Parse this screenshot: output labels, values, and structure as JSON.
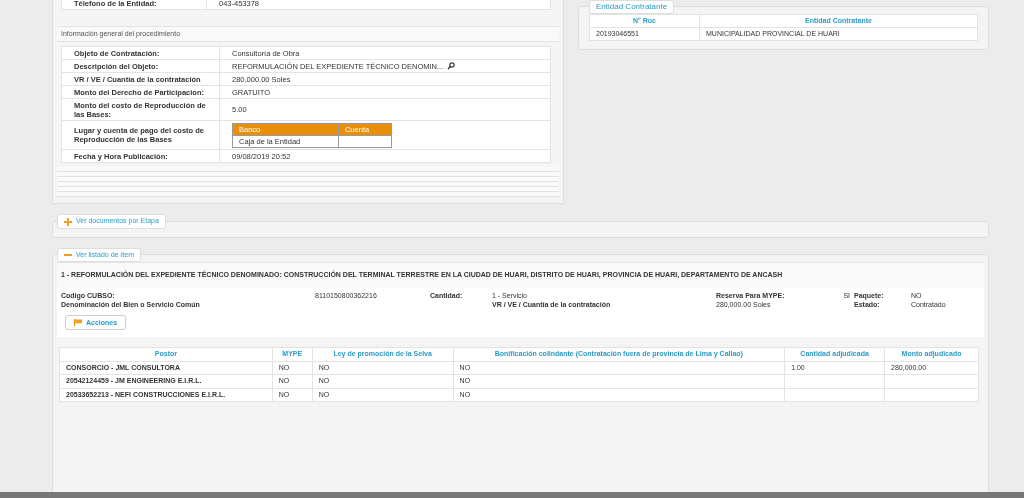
{
  "entity_info": {
    "rows": [
      {
        "label": "Télefono de la Entidad:",
        "value": "043-453378"
      }
    ]
  },
  "procedure": {
    "title": "Información general del procedimiento",
    "rows": [
      {
        "kind": "text",
        "label": "Objeto de Contratación:",
        "value": "Consultoría de Obra"
      },
      {
        "kind": "search",
        "label": "Descripción del Objeto:",
        "value": "REFORMULACIÓN DEL EXPEDIENTE TÉCNICO DENOMIN..."
      },
      {
        "kind": "text",
        "label": "VR / VE / Cuantía de la contratación",
        "value": "280,000.00  Soles"
      },
      {
        "kind": "text",
        "label": "Monto del Derecho de Participacion:",
        "value": "GRATUITO"
      },
      {
        "kind": "text",
        "label": "Monto del costo de Reproducción de las Bases:",
        "value": "5.00"
      },
      {
        "kind": "payment",
        "label": "Lugar y cuenta de pago del costo de Reproducción de las Bases",
        "columns": [
          "Banco",
          "Cuenta"
        ],
        "rows": [
          [
            "Caja de la Entidad",
            null
          ]
        ]
      },
      {
        "kind": "text",
        "label": "Fecha y Hora Publicación:",
        "value": "09/08/2019 20:52"
      }
    ]
  },
  "entidad_contratante": {
    "legend": "Entidad Contratante",
    "columns": [
      "N° Ruc",
      "Entidad Contratante"
    ],
    "rows": [
      [
        "20193046551",
        "MUNICIPALIDAD PROVINCIAL DE HUARI"
      ]
    ]
  },
  "documents": {
    "label": "Ver documentos por Etapa",
    "expanded": false
  },
  "items": {
    "label": "Ver listado de ítem",
    "expanded": true,
    "title": "1 - REFORMULACIÓN DEL EXPEDIENTE TÉCNICO DENOMINADO: CONSTRUCCIÓN DEL TERMINAL TERRESTRE EN LA CIUDAD DE HUARI, DISTRITO DE HUARI, PROVINCIA DE HUARI, DEPARTAMENTO DE ANCASH",
    "details": [
      [
        {
          "kind": "label",
          "text": "Codigo CUBSO:"
        },
        {
          "kind": "value",
          "text": "8110150800362216"
        },
        {
          "kind": "label",
          "text": "Cantidad:"
        },
        {
          "kind": "value",
          "text": "1 - Servicio"
        },
        {
          "kind": "label",
          "text": "Reserva Para MYPE:"
        },
        {
          "kind": "value",
          "text": "SI"
        },
        {
          "kind": "label",
          "text": "Paquete:"
        },
        {
          "kind": "value",
          "text": "NO"
        }
      ],
      [
        {
          "kind": "label",
          "text": "Denominación del Bien o Servicio Común"
        },
        {
          "kind": "label",
          "text": "VR / VE / Cuantía de la contratación"
        },
        {
          "kind": "value",
          "text": "280,000.00 Soles"
        },
        {
          "kind": "label",
          "text": "Estado:"
        },
        {
          "kind": "value",
          "text": "Contratado"
        }
      ]
    ],
    "actions": "Acciones",
    "table": {
      "columns": [
        "Postor",
        "MYPE",
        "Ley de promoción de la Selva",
        "Bonificación colindante (Contratación fuera de provincia de Lima y Callao)",
        "Cantidad adjudicada",
        "Monto adjudicado"
      ],
      "rows": [
        [
          "CONSORCIO - JML CONSULTORA",
          "NO",
          "NO",
          "NO",
          "1.00",
          "280,000.00"
        ],
        [
          "20542124459 - JM ENGINEERING E.I.R.L.",
          "NO",
          "NO",
          "NO",
          null,
          null
        ],
        [
          "20533652213 - NEFI CONSTRUCCIONES E.I.R.L.",
          "NO",
          "NO",
          "NO",
          null,
          null
        ]
      ]
    }
  }
}
